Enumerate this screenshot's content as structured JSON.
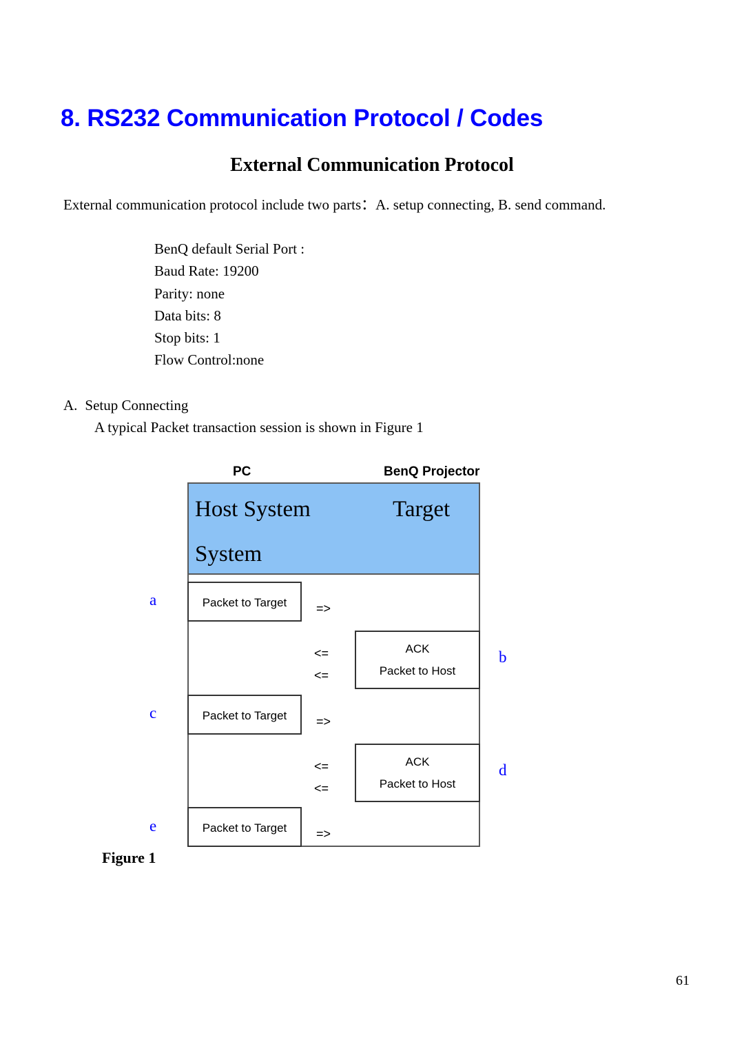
{
  "document": {
    "title": "8. RS232 Communication Protocol / Codes",
    "subtitle": "External Communication Protocol",
    "title_color": "#0000ff",
    "intro": "External communication protocol include two parts：A. setup connecting, B. send command.",
    "serial_settings": [
      "BenQ default Serial Port :",
      "Baud Rate: 19200",
      "Parity: none",
      "Data bits: 8",
      "Stop bits: 1",
      "Flow Control:none"
    ],
    "section_a": {
      "label": "A.",
      "heading": "Setup Connecting",
      "description": "A typical Packet transaction session is shown in Figure 1"
    },
    "page_number": "61"
  },
  "figure": {
    "caption": "Figure 1",
    "column_headers": {
      "left": "PC",
      "right": "BenQ Projector"
    },
    "banner": {
      "background_color": "#8cc2f5",
      "host_label": "Host System",
      "target_label": "Target",
      "system_label": "System"
    },
    "step_letters": [
      "a",
      "b",
      "c",
      "d",
      "e"
    ],
    "step_letter_color": "#0000ff",
    "messages": [
      {
        "step": "a",
        "direction": "host-to-target",
        "box_text": "Packet to Target",
        "arrow": "=>"
      },
      {
        "step": "b",
        "direction": "target-to-host",
        "box_line1": "ACK",
        "box_line2": "Packet to Host",
        "arrow1": "<=",
        "arrow2": "<="
      },
      {
        "step": "c",
        "direction": "host-to-target",
        "box_text": "Packet to Target",
        "arrow": "=>"
      },
      {
        "step": "d",
        "direction": "target-to-host",
        "box_line1": "ACK",
        "box_line2": "Packet to Host",
        "arrow1": "<=",
        "arrow2": "<="
      },
      {
        "step": "e",
        "direction": "host-to-target",
        "box_text": "Packet to Target",
        "arrow": "=>"
      }
    ]
  }
}
